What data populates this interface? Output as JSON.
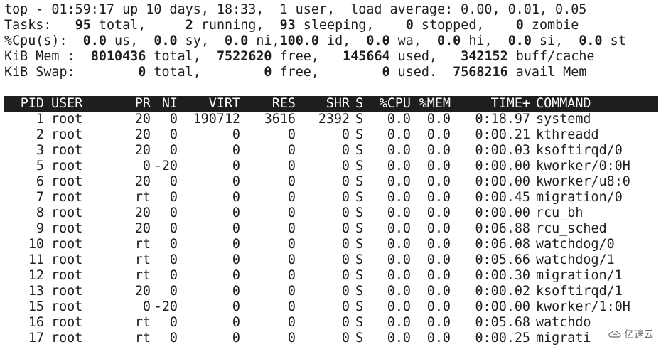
{
  "summary": {
    "line1": "top - 01:59:17 up 10 days, 18:33,  1 user,  load average: 0.00, 0.01, 0.05",
    "tasks": {
      "label": "Tasks:",
      "total": "95",
      "running": "2",
      "sleeping": "93",
      "stopped": "0",
      "zombie": "0"
    },
    "cpu": {
      "label": "%Cpu(s):",
      "us": "0.0",
      "sy": "0.0",
      "ni": "0.0",
      "id": "100.0",
      "wa": "0.0",
      "hi": "0.0",
      "si": "0.0",
      "st": "0.0"
    },
    "mem": {
      "label": "KiB Mem :",
      "total": "8010436",
      "free": "7522620",
      "used": "145664",
      "buff_cache": "342152"
    },
    "swap": {
      "label": "KiB Swap:",
      "total": "0",
      "free": "0",
      "used": "0",
      "avail_mem": "7568216"
    }
  },
  "table": {
    "headers": [
      "PID",
      "USER",
      "PR",
      "NI",
      "VIRT",
      "RES",
      "SHR",
      "S",
      "%CPU",
      "%MEM",
      "TIME+",
      "COMMAND"
    ],
    "rows": [
      [
        "1",
        "root",
        "20",
        "0",
        "190712",
        "3616",
        "2392",
        "S",
        "0.0",
        "0.0",
        "0:18.97",
        "systemd"
      ],
      [
        "2",
        "root",
        "20",
        "0",
        "0",
        "0",
        "0",
        "S",
        "0.0",
        "0.0",
        "0:00.21",
        "kthreadd"
      ],
      [
        "3",
        "root",
        "20",
        "0",
        "0",
        "0",
        "0",
        "S",
        "0.0",
        "0.0",
        "0:00.03",
        "ksoftirqd/0"
      ],
      [
        "5",
        "root",
        "0",
        "-20",
        "0",
        "0",
        "0",
        "S",
        "0.0",
        "0.0",
        "0:00.00",
        "kworker/0:0H"
      ],
      [
        "6",
        "root",
        "20",
        "0",
        "0",
        "0",
        "0",
        "S",
        "0.0",
        "0.0",
        "0:00.00",
        "kworker/u8:0"
      ],
      [
        "7",
        "root",
        "rt",
        "0",
        "0",
        "0",
        "0",
        "S",
        "0.0",
        "0.0",
        "0:00.45",
        "migration/0"
      ],
      [
        "8",
        "root",
        "20",
        "0",
        "0",
        "0",
        "0",
        "S",
        "0.0",
        "0.0",
        "0:00.00",
        "rcu_bh"
      ],
      [
        "9",
        "root",
        "20",
        "0",
        "0",
        "0",
        "0",
        "S",
        "0.0",
        "0.0",
        "0:06.88",
        "rcu_sched"
      ],
      [
        "10",
        "root",
        "rt",
        "0",
        "0",
        "0",
        "0",
        "S",
        "0.0",
        "0.0",
        "0:06.08",
        "watchdog/0"
      ],
      [
        "11",
        "root",
        "rt",
        "0",
        "0",
        "0",
        "0",
        "S",
        "0.0",
        "0.0",
        "0:05.66",
        "watchdog/1"
      ],
      [
        "12",
        "root",
        "rt",
        "0",
        "0",
        "0",
        "0",
        "S",
        "0.0",
        "0.0",
        "0:00.30",
        "migration/1"
      ],
      [
        "13",
        "root",
        "20",
        "0",
        "0",
        "0",
        "0",
        "S",
        "0.0",
        "0.0",
        "0:00.02",
        "ksoftirqd/1"
      ],
      [
        "15",
        "root",
        "0",
        "-20",
        "0",
        "0",
        "0",
        "S",
        "0.0",
        "0.0",
        "0:00.00",
        "kworker/1:0H"
      ],
      [
        "16",
        "root",
        "rt",
        "0",
        "0",
        "0",
        "0",
        "S",
        "0.0",
        "0.0",
        "0:05.68",
        "watchdo"
      ],
      [
        "17",
        "root",
        "rt",
        "0",
        "0",
        "0",
        "0",
        "S",
        "0.0",
        "0.0",
        "0:00.25",
        "migrati"
      ]
    ]
  },
  "watermark": {
    "text": "亿速云",
    "icon": "cloud-logo-icon"
  }
}
